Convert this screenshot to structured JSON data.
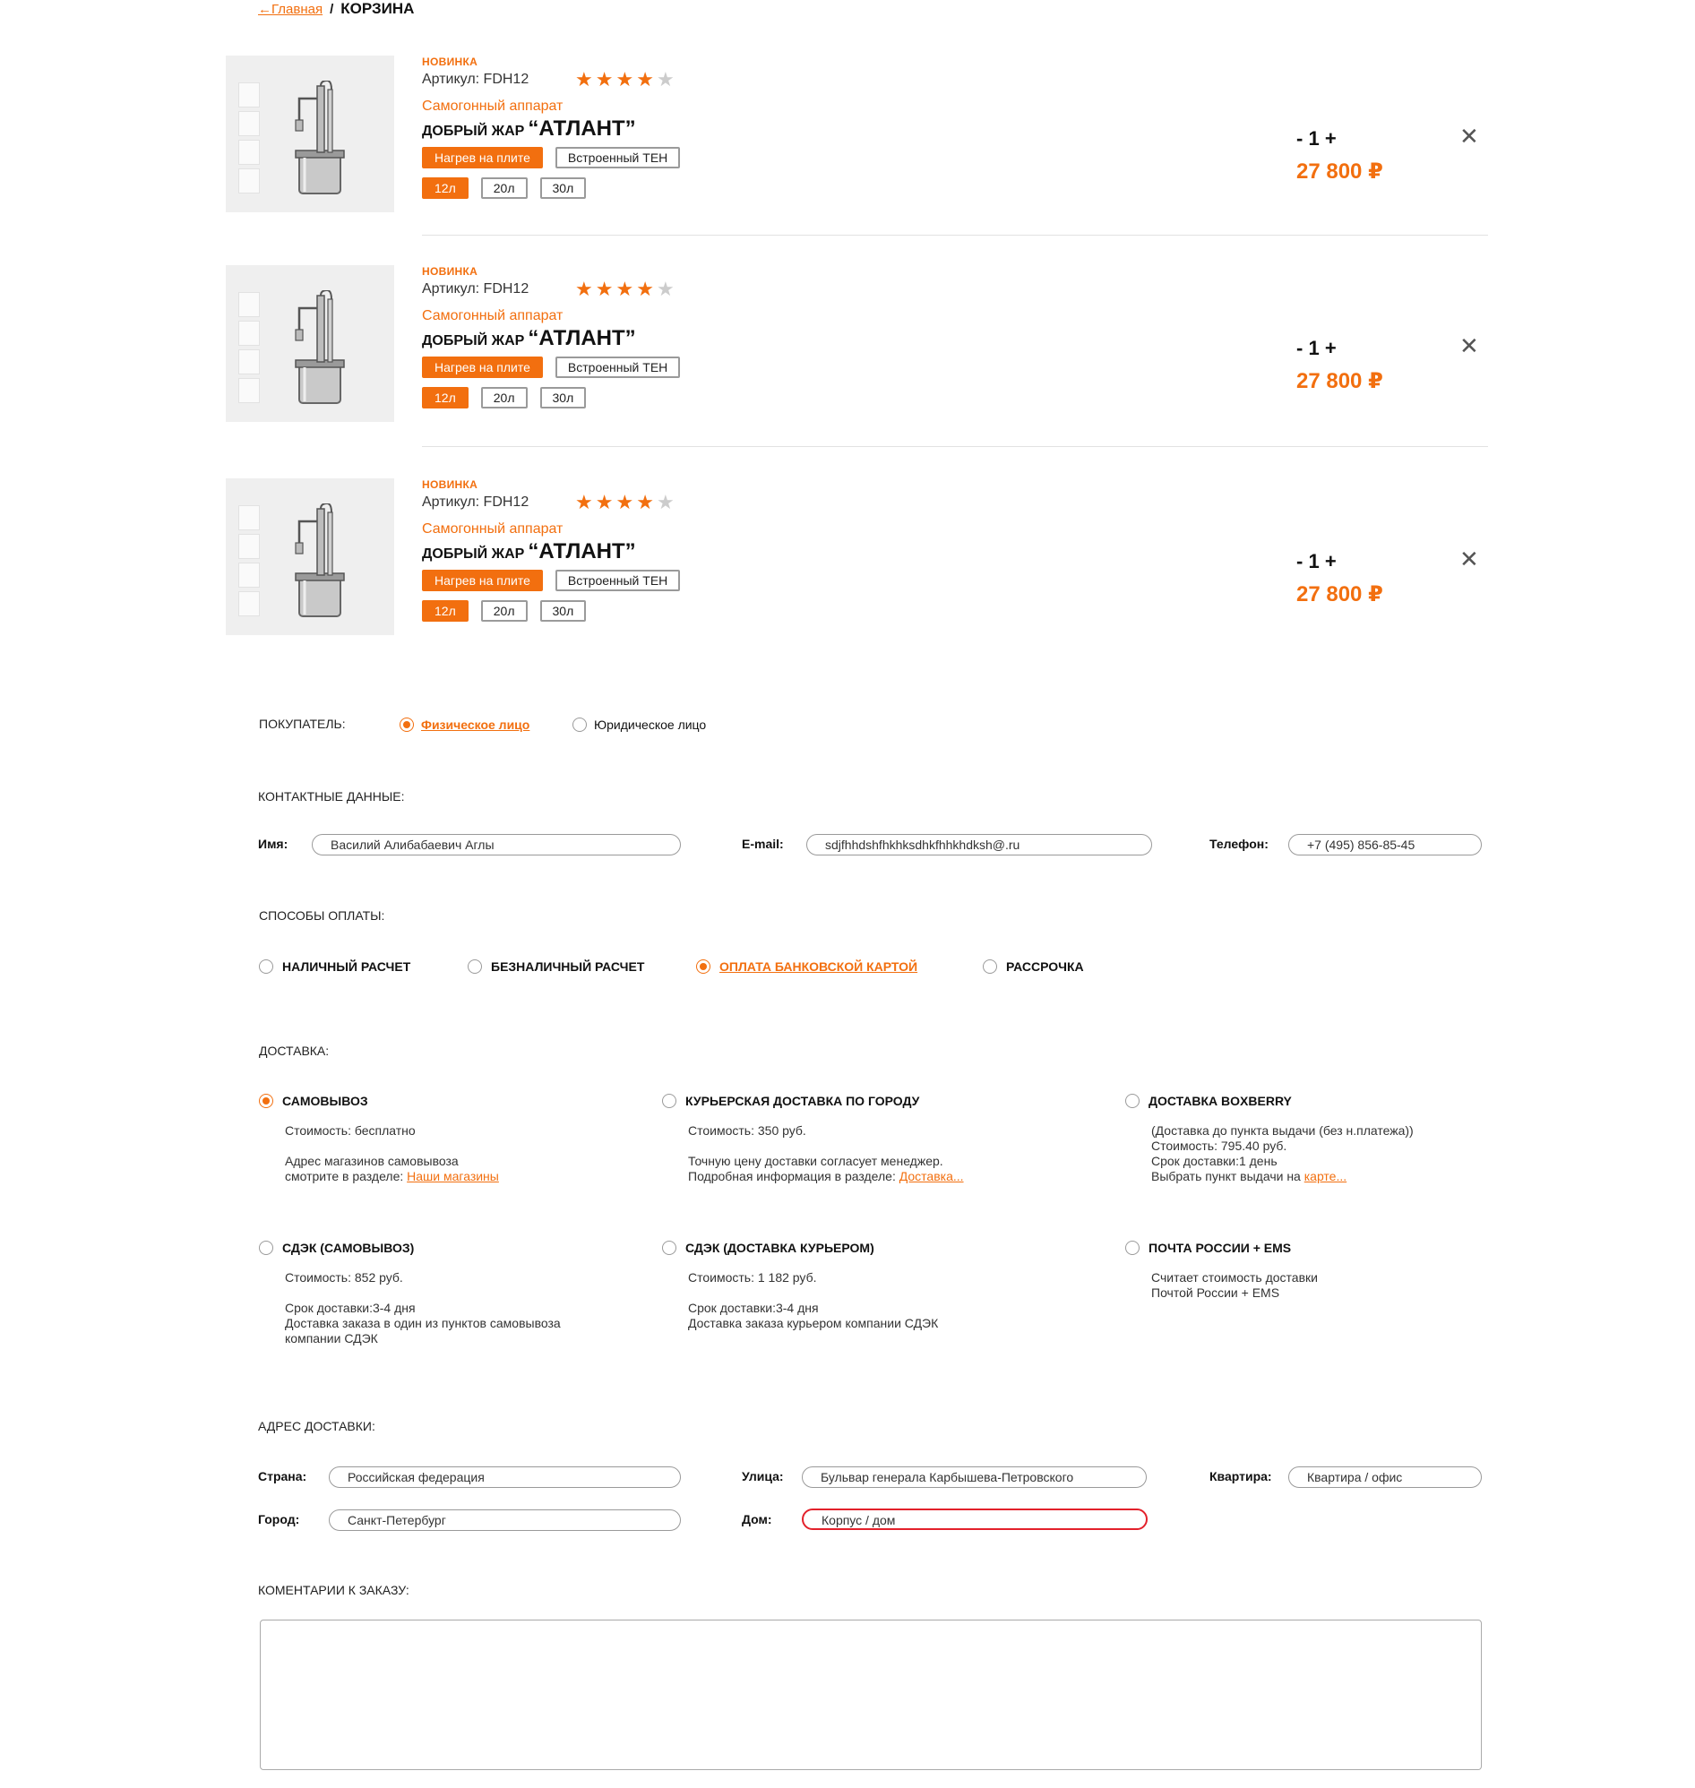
{
  "breadcrumb": {
    "home": "←Главная",
    "separator": "/",
    "current": "КОРЗИНА"
  },
  "products": [
    {
      "badge": "НОВИНКА",
      "sku": "Артикул: FDH12",
      "rating": 4,
      "rating_max": 5,
      "category": "Самогонный аппарат",
      "brand": "ДОБРЫЙ ЖАР",
      "model": "“АТЛАНТ”",
      "heat_options": [
        "Нагрев на плите",
        "Встроенный ТЕН"
      ],
      "heat_selected": 0,
      "volumes": [
        "12л",
        "20л",
        "30л"
      ],
      "volume_selected": 0,
      "qty_minus": "-",
      "qty": "1",
      "qty_plus": "+",
      "price": "27 800 ₽"
    },
    {
      "badge": "НОВИНКА",
      "sku": "Артикул: FDH12",
      "rating": 4,
      "rating_max": 5,
      "category": "Самогонный аппарат",
      "brand": "ДОБРЫЙ ЖАР",
      "model": "“АТЛАНТ”",
      "heat_options": [
        "Нагрев на плите",
        "Встроенный ТЕН"
      ],
      "heat_selected": 0,
      "volumes": [
        "12л",
        "20л",
        "30л"
      ],
      "volume_selected": 0,
      "qty_minus": "-",
      "qty": "1",
      "qty_plus": "+",
      "price": "27 800 ₽"
    },
    {
      "badge": "НОВИНКА",
      "sku": "Артикул: FDH12",
      "rating": 4,
      "rating_max": 5,
      "category": "Самогонный аппарат",
      "brand": "ДОБРЫЙ ЖАР",
      "model": "“АТЛАНТ”",
      "heat_options": [
        "Нагрев на плите",
        "Встроенный ТЕН"
      ],
      "heat_selected": 0,
      "volumes": [
        "12л",
        "20л",
        "30л"
      ],
      "volume_selected": 0,
      "qty_minus": "-",
      "qty": "1",
      "qty_plus": "+",
      "price": "27 800 ₽"
    }
  ],
  "buyer": {
    "label": "ПОКУПАТЕЛЬ:",
    "options": [
      "Физическое лицо",
      "Юридическое лицо"
    ],
    "selected": 0
  },
  "contacts": {
    "label": "КОНТАКТНЫЕ ДАННЫЕ:",
    "name_label": "Имя:",
    "name_value": "Василий Алибабаевич Аглы",
    "email_label": "E-mail:",
    "email_value": "sdjfhhdshfhkhksdhkfhhkhdksh@.ru",
    "phone_label": "Телефон:",
    "phone_value": "+7 (495) 856-85-45"
  },
  "payment": {
    "label": "СПОСОБЫ ОПЛАТЫ:",
    "options": [
      "НАЛИЧНЫЙ РАСЧЕТ",
      "БЕЗНАЛИЧНЫЙ РАСЧЕТ",
      "ОПЛАТА БАНКОВСКОЙ КАРТОЙ",
      "РАССРОЧКА"
    ],
    "selected": 2
  },
  "delivery": {
    "label": "ДОСТАВКА:",
    "selected": 0,
    "options": [
      {
        "title": "САМОВЫВОЗ",
        "lines": [
          "Стоимость: бесплатно",
          "",
          "Адрес магазинов самовывоза",
          "смотрите в разделе: "
        ],
        "link": "Наши магазины"
      },
      {
        "title": "КУРЬЕРСКАЯ ДОСТАВКА ПО ГОРОДУ",
        "lines": [
          "Стоимость: 350 руб.",
          "",
          "Точную цену доставки согласует менеджер.",
          "Подробная информация в разделе: "
        ],
        "link": "Доставка..."
      },
      {
        "title": "ДОСТАВКА BOXBERRY",
        "lines": [
          "(Доставка до пункта выдачи (без н.платежа))",
          "Стоимость: 795.40 руб.",
          "Срок доставки:1 день",
          "Выбрать пункт выдачи на "
        ],
        "link": "карте..."
      },
      {
        "title": "СДЭК (САМОВЫВОЗ)",
        "lines": [
          "Стоимость: 852 руб.",
          "",
          "Срок доставки:3-4 дня",
          "Доставка заказа в один из пунктов самовывоза",
          "компании СДЭК"
        ],
        "link": ""
      },
      {
        "title": "СДЭК (ДОСТАВКА КУРЬЕРОМ)",
        "lines": [
          "Стоимость: 1 182 руб.",
          "",
          "Срок доставки:3-4 дня",
          "Доставка заказа курьером компании СДЭК"
        ],
        "link": ""
      },
      {
        "title": "ПОЧТА РОССИИ + EMS",
        "lines": [
          "Считает стоимость доставки",
          "Почтой России + EMS"
        ],
        "link": ""
      }
    ]
  },
  "address": {
    "label": "АДРЕС ДОСТАВКИ:",
    "country_label": "Страна:",
    "country_value": "Российская федерация",
    "city_label": "Город:",
    "city_value": "Санкт-Петербург",
    "street_label": "Улица:",
    "street_value": "Бульвар генерала Карбышева-Петровского",
    "house_label": "Дом:",
    "house_placeholder": "Корпус / дом",
    "flat_label": "Квартира:",
    "flat_placeholder": "Квартира / офис"
  },
  "comment": {
    "label": "КОМЕНТАРИИ К ЗАКАЗУ:"
  },
  "colors": {
    "accent": "#f26f0f",
    "error": "#e3212b",
    "star_off": "#cccccc"
  }
}
